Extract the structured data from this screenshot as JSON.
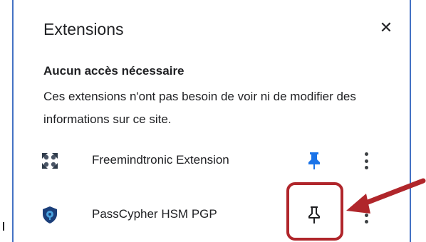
{
  "dialog": {
    "title": "Extensions",
    "close_label": "✕"
  },
  "section": {
    "heading": "Aucun accès nécessaire",
    "description": "Ces extensions n'ont pas besoin de voir ni de modifier des informations sur ce site."
  },
  "extensions": [
    {
      "name": "Freemindtronic Extension",
      "icon": "freemindtronic-logo-icon",
      "pinned": true,
      "pin_color": "#1a73e8"
    },
    {
      "name": "PassCypher HSM PGP",
      "icon": "passcypher-shield-icon",
      "pinned": false,
      "pin_color": "#202124"
    }
  ],
  "annotation": {
    "highlight_color": "#b0262b"
  }
}
